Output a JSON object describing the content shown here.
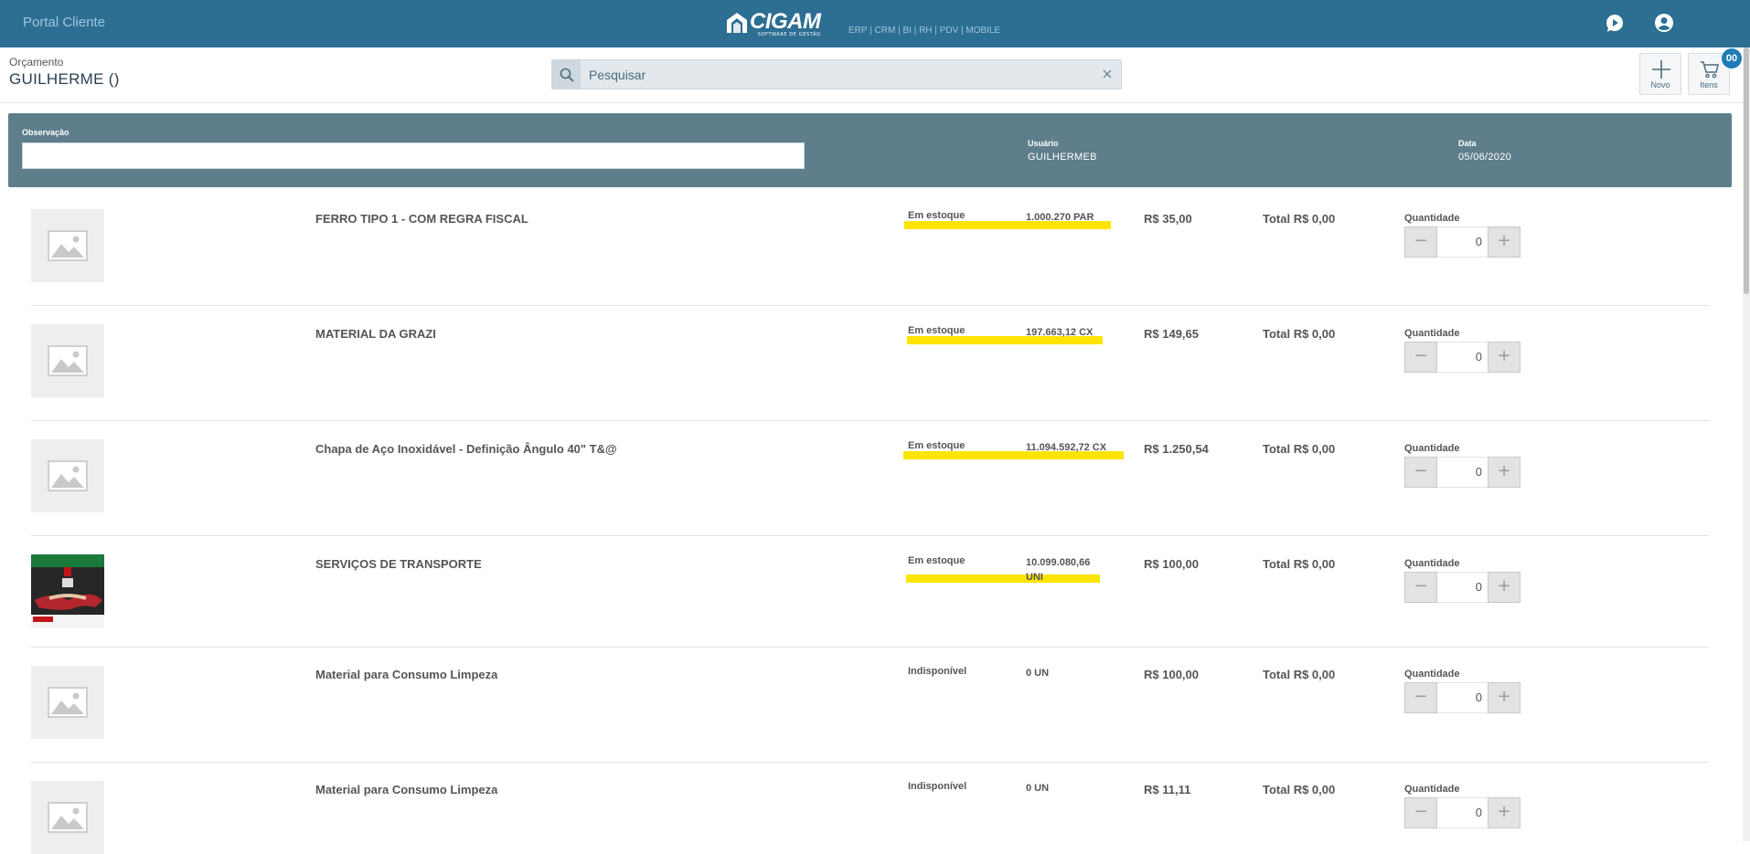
{
  "app": {
    "portal_title": "Portal Cliente",
    "logo_word": "CIGAM",
    "logo_sub": "SOFTWARE DE GESTÃO",
    "modules": "ERP | CRM | BI | RH | PDV | MOBILE"
  },
  "header": {
    "subtitle": "Orçamento",
    "title": "GUILHERME ()",
    "search_placeholder": "Pesquisar",
    "novo_label": "Novo",
    "itens_label": "Itens",
    "cart_count": "00"
  },
  "info": {
    "obs_label": "Observação",
    "obs_value": "",
    "user_label": "Usuário",
    "user_value": "GUILHERMEB",
    "date_label": "Data",
    "date_value": "05/06/2020"
  },
  "products": [
    {
      "name": "FERRO TIPO 1 - COM REGRA FISCAL",
      "status": "Em estoque",
      "stock": "1.000.270 PAR",
      "price": "R$ 35,00",
      "total": "Total R$ 0,00",
      "qty_label": "Quantidade",
      "qty": "0"
    },
    {
      "name": "MATERIAL DA GRAZI",
      "status": "Em estoque",
      "stock": "197.663,12 CX",
      "price": "R$ 149,65",
      "total": "Total R$ 0,00",
      "qty_label": "Quantidade",
      "qty": "0"
    },
    {
      "name": "Chapa de Aço Inoxidável - Definição Ângulo 40\" T&@",
      "status": "Em estoque",
      "stock": "11.094.592,72 CX",
      "price": "R$ 1.250,54",
      "total": "Total R$ 0,00",
      "qty_label": "Quantidade",
      "qty": "0"
    },
    {
      "name": "SERVIÇOS DE TRANSPORTE",
      "status": "Em estoque",
      "stock": "10.099.080,66 UNI",
      "price": "R$ 100,00",
      "total": "Total R$ 0,00",
      "qty_label": "Quantidade",
      "qty": "0"
    },
    {
      "name": "Material para Consumo Limpeza",
      "status": "Indisponível",
      "stock": "0 UN",
      "price": "R$ 100,00",
      "total": "Total R$ 0,00",
      "qty_label": "Quantidade",
      "qty": "0"
    },
    {
      "name": "Material para Consumo Limpeza",
      "status": "Indisponível",
      "stock": "0 UN",
      "price": "R$ 11,11",
      "total": "Total R$ 0,00",
      "qty_label": "Quantidade",
      "qty": "0"
    }
  ],
  "stepper": {
    "minus": "−",
    "plus": "+"
  },
  "colors": {
    "topbar": "#2d6e93",
    "panel": "#5e7e8c",
    "highlight": "#ffe400",
    "badge": "#1e7bb5"
  },
  "icons": {
    "chat": "chat-icon",
    "user": "user-icon",
    "search": "search-icon",
    "clear": "close-icon",
    "add": "plus-icon",
    "cart": "cart-icon",
    "image_placeholder": "image-placeholder-icon"
  }
}
